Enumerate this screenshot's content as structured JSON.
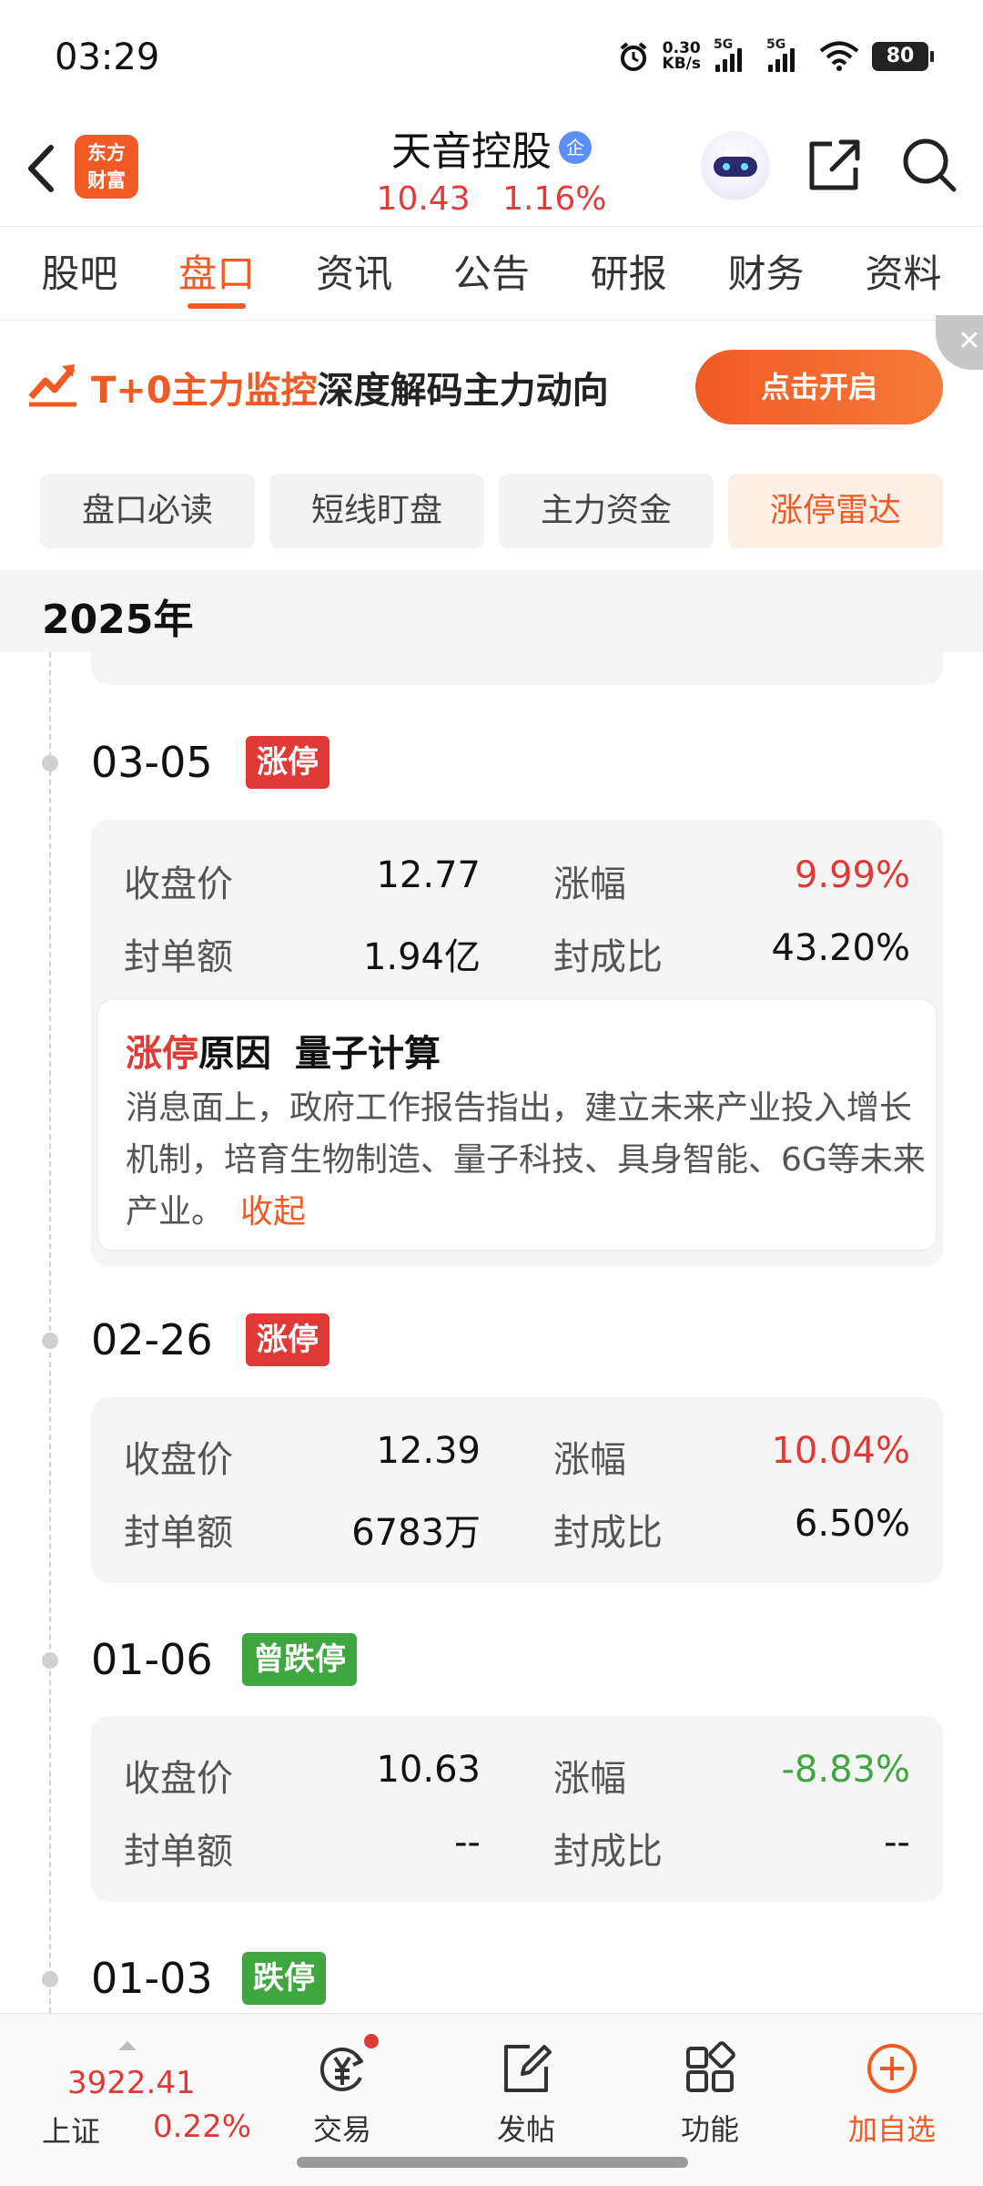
{
  "status_bar": {
    "time": "03:29",
    "net_speed_value": "0.30",
    "net_speed_unit": "KB/s",
    "signal1_label": "5G",
    "signal2_label": "5G",
    "battery": "80"
  },
  "header": {
    "logo_line1": "东方",
    "logo_line2": "财富",
    "stock_name": "天音控股",
    "stock_badge": "企",
    "price": "10.43",
    "change_pct": "1.16%"
  },
  "tabs": [
    {
      "label": "股吧"
    },
    {
      "label": "盘口",
      "active": true
    },
    {
      "label": "资讯"
    },
    {
      "label": "公告"
    },
    {
      "label": "研报"
    },
    {
      "label": "财务"
    },
    {
      "label": "资料"
    }
  ],
  "banner": {
    "highlight": "T+0主力监控",
    "text": "深度解码主力动向",
    "button": "点击开启",
    "close": "✕"
  },
  "subtabs": [
    {
      "label": "盘口必读"
    },
    {
      "label": "短线盯盘"
    },
    {
      "label": "主力资金"
    },
    {
      "label": "涨停雷达",
      "active": true
    }
  ],
  "year": "2025年",
  "labels": {
    "close_price": "收盘价",
    "change": "涨幅",
    "seal_amount": "封单额",
    "seal_ratio": "封成比"
  },
  "entries": [
    {
      "date": "03-05",
      "badge": "涨停",
      "close_price": "12.77",
      "change": "9.99%",
      "seal_amount": "1.94亿",
      "seal_ratio": "43.20%",
      "reason_title_hl": "涨停",
      "reason_title": "原因",
      "reason_topic": "量子计算",
      "reason_text": "消息面上，政府工作报告指出，建立未来产业投入增长机制，培育生物制造、量子科技、具身智能、6G等未来产业。",
      "collapse": "收起"
    },
    {
      "date": "02-26",
      "badge": "涨停",
      "close_price": "12.39",
      "change": "10.04%",
      "seal_amount": "6783万",
      "seal_ratio": "6.50%"
    },
    {
      "date": "01-06",
      "badge": "曾跌停",
      "close_price": "10.63",
      "change": "-8.83%",
      "seal_amount": "--",
      "seal_ratio": "--"
    },
    {
      "date": "01-03",
      "badge": "跌停"
    }
  ],
  "bottom_bar": {
    "index_value": "3922.41",
    "index_name": "上证",
    "index_change": "0.22%",
    "nav": [
      {
        "label": "交易",
        "icon": "yuan-exchange-icon"
      },
      {
        "label": "发帖",
        "icon": "edit-post-icon"
      },
      {
        "label": "功能",
        "icon": "grid-apps-icon"
      },
      {
        "label": "加自选",
        "icon": "plus-circle-icon"
      }
    ]
  },
  "colors": {
    "accent": "#f05a24",
    "rise": "#e03a36",
    "fall": "#3fa640"
  }
}
